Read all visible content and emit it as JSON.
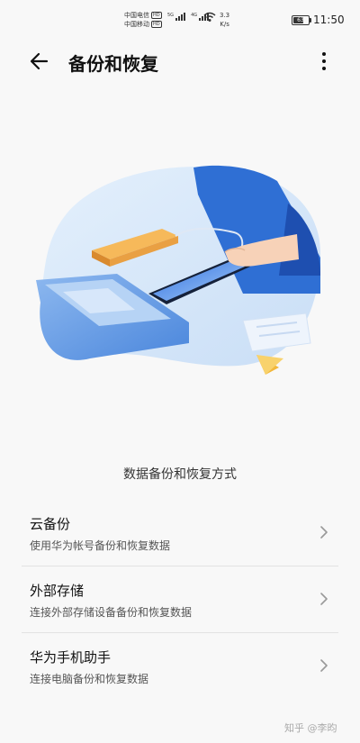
{
  "status": {
    "carrier1": "中国电信",
    "carrier2": "中国移动",
    "hd_label": "HD",
    "net1": "5G",
    "net2": "4G",
    "speed_value": "3.3",
    "speed_unit": "K/s",
    "battery": "63",
    "time": "11:50"
  },
  "header": {
    "title": "备份和恢复",
    "back_icon": "arrow-left-icon",
    "more_icon": "more-vertical-icon"
  },
  "illustration": {
    "name": "phone-backup-illustration"
  },
  "section_title": "数据备份和恢复方式",
  "options": [
    {
      "title": "云备份",
      "subtitle": "使用华为帐号备份和恢复数据"
    },
    {
      "title": "外部存储",
      "subtitle": "连接外部存储设备备份和恢复数据"
    },
    {
      "title": "华为手机助手",
      "subtitle": "连接电脑备份和恢复数据"
    }
  ],
  "watermark": "知乎 @李昀",
  "colors": {
    "accent_blue": "#3b78e0",
    "background": "#f8f8f8"
  }
}
